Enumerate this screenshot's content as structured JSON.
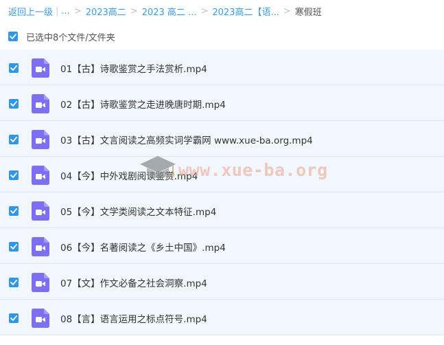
{
  "breadcrumb": {
    "back_label": "返回上一级",
    "ellipsis": "...",
    "items": [
      "2023高二",
      "2023 高二 ...",
      "2023高二【语..."
    ],
    "current": "寒假班"
  },
  "selection": {
    "label": "已选中8个文件/文件夹"
  },
  "files": [
    {
      "name": "01【古】诗歌鉴赏之手法赏析.mp4"
    },
    {
      "name": "02【古】诗歌鉴赏之走进晚唐时期.mp4"
    },
    {
      "name": "03【古】文言阅读之高频实词学霸网 www.xue-ba.org.mp4"
    },
    {
      "name": "04【今】中外戏剧阅读鉴赏.mp4"
    },
    {
      "name": "05【今】文学类阅读之文本特征.mp4"
    },
    {
      "name": "06【今】名著阅读之《乡土中国》.mp4"
    },
    {
      "name": "07【文】作文必备之社会洞察.mp4"
    },
    {
      "name": "08【言】语言运用之标点符号.mp4"
    }
  ],
  "watermark": {
    "text": "www.xue-ba.org"
  },
  "colors": {
    "accent": "#3296e6",
    "link": "#3a9be6",
    "row_bg": "#f1f7fd",
    "video_icon": "#7b6ff2"
  },
  "icons": {
    "checkbox": "checkbox-checked-icon",
    "file": "video-file-icon",
    "watermark": "graduation-cap-icon"
  }
}
